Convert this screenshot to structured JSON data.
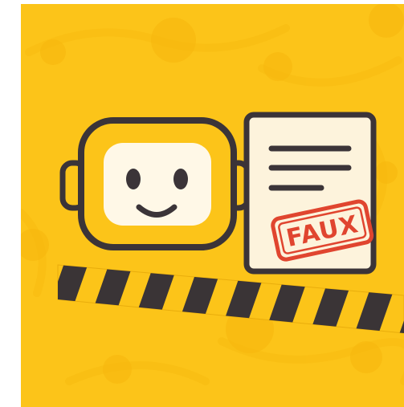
{
  "illustration": {
    "background_color": "#fcc419",
    "pattern_color": "#f6b80e",
    "outline_color": "#3b3438",
    "robot": {
      "head_color": "#fcc419",
      "face_color": "#fff8e7",
      "expression": "smile"
    },
    "document": {
      "paper_color": "#fdf3dc",
      "stamp": {
        "text": "FAUX",
        "color": "#e0452f"
      }
    },
    "caution_tape": {
      "stripe_color": "#3a3436",
      "base_color": "#fcc419"
    }
  }
}
